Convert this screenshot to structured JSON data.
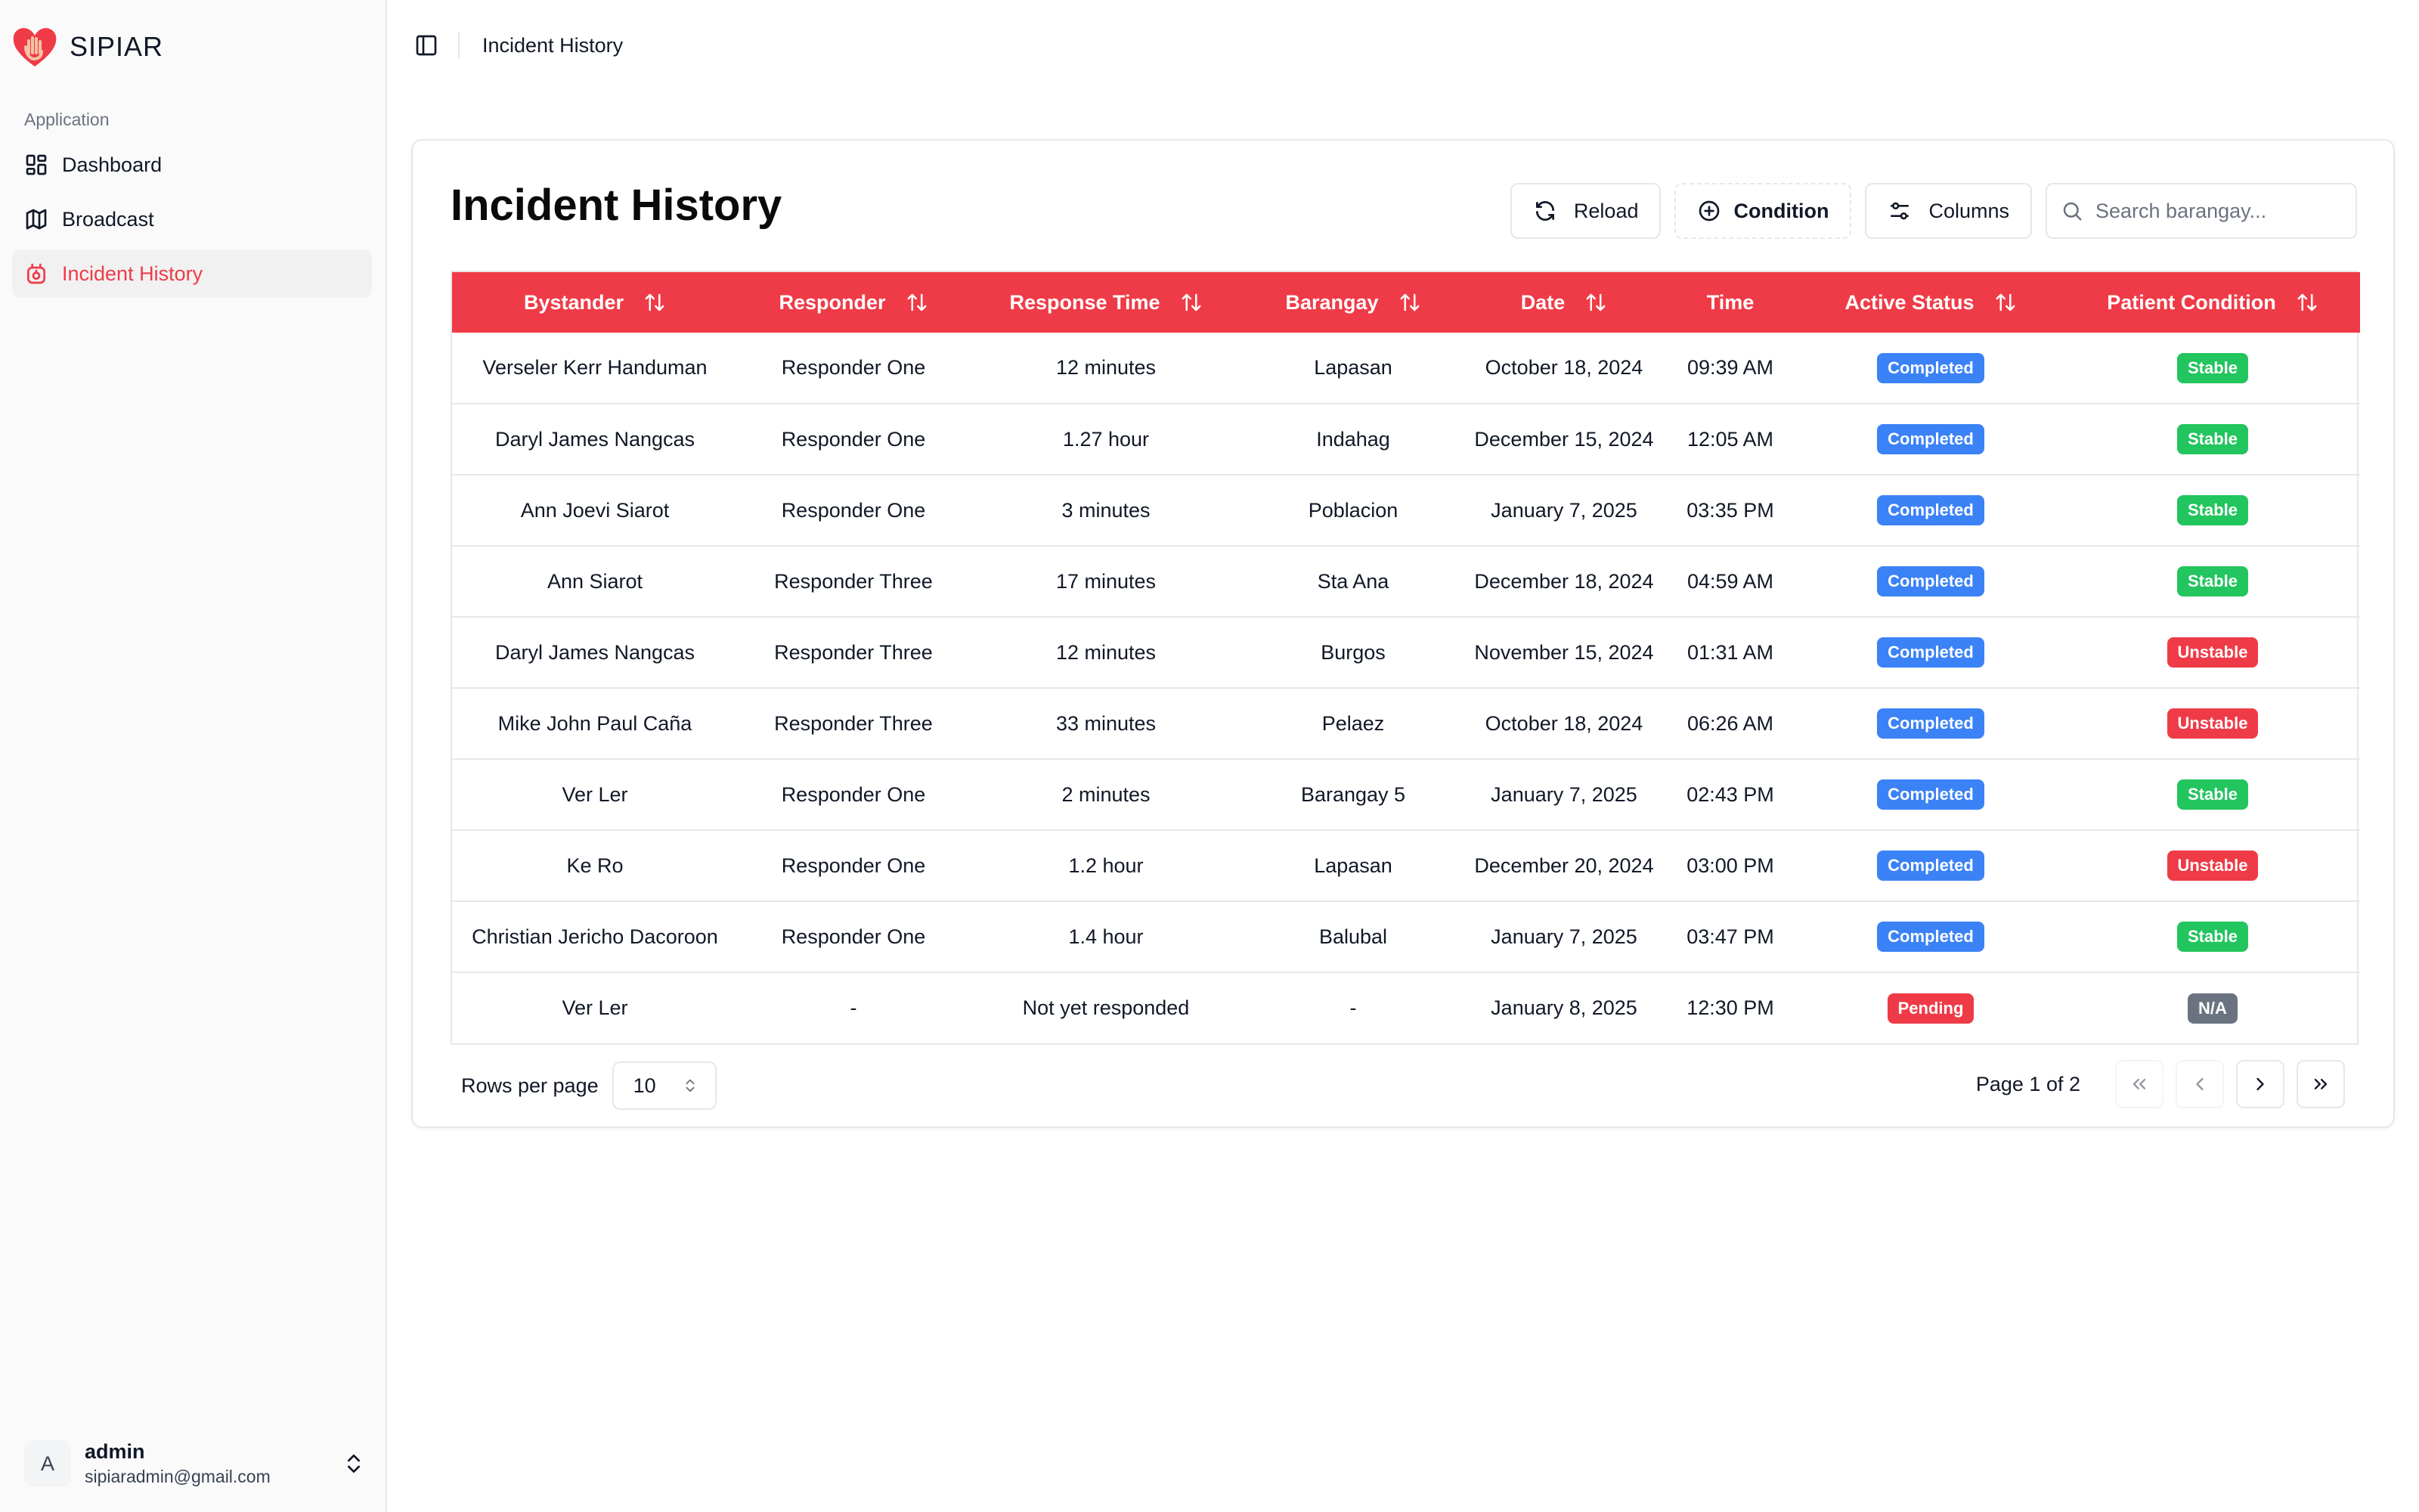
{
  "app": {
    "name": "SIPIAR"
  },
  "sidebar": {
    "group_label": "Application",
    "items": [
      {
        "label": "Dashboard",
        "icon": "layout-dashboard-icon",
        "active": false
      },
      {
        "label": "Broadcast",
        "icon": "map-icon",
        "active": true
      },
      {
        "label": "Incident History",
        "icon": "incident-history-icon",
        "active": true
      }
    ],
    "user": {
      "initial": "A",
      "name": "admin",
      "email": "sipiaradmin@gmail.com"
    }
  },
  "header": {
    "breadcrumb": "Incident History"
  },
  "main": {
    "title": "Incident History",
    "toolbar": {
      "reload_label": "Reload",
      "condition_label": "Condition",
      "columns_label": "Columns",
      "search_placeholder": "Search barangay..."
    },
    "table": {
      "columns": [
        "Bystander",
        "Responder",
        "Response Time",
        "Barangay",
        "Date",
        "Time",
        "Active Status",
        "Patient Condition"
      ],
      "rows": [
        {
          "bystander": "Verseler Kerr Handuman",
          "responder": "Responder One",
          "response_time": "12 minutes",
          "barangay": "Lapasan",
          "date": "October 18, 2024",
          "time": "09:39 AM",
          "status": "Completed",
          "condition": "Stable"
        },
        {
          "bystander": "Daryl James Nangcas",
          "responder": "Responder One",
          "response_time": "1.27 hour",
          "barangay": "Indahag",
          "date": "December 15, 2024",
          "time": "12:05 AM",
          "status": "Completed",
          "condition": "Stable"
        },
        {
          "bystander": "Ann Joevi Siarot",
          "responder": "Responder One",
          "response_time": "3 minutes",
          "barangay": "Poblacion",
          "date": "January 7, 2025",
          "time": "03:35 PM",
          "status": "Completed",
          "condition": "Stable"
        },
        {
          "bystander": "Ann Siarot",
          "responder": "Responder Three",
          "response_time": "17 minutes",
          "barangay": "Sta Ana",
          "date": "December 18, 2024",
          "time": "04:59 AM",
          "status": "Completed",
          "condition": "Stable"
        },
        {
          "bystander": "Daryl James Nangcas",
          "responder": "Responder Three",
          "response_time": "12 minutes",
          "barangay": "Burgos",
          "date": "November 15, 2024",
          "time": "01:31 AM",
          "status": "Completed",
          "condition": "Unstable"
        },
        {
          "bystander": "Mike John Paul Caña",
          "responder": "Responder Three",
          "response_time": "33 minutes",
          "barangay": "Pelaez",
          "date": "October 18, 2024",
          "time": "06:26 AM",
          "status": "Completed",
          "condition": "Unstable"
        },
        {
          "bystander": "Ver Ler",
          "responder": "Responder One",
          "response_time": "2 minutes",
          "barangay": "Barangay 5",
          "date": "January 7, 2025",
          "time": "02:43 PM",
          "status": "Completed",
          "condition": "Stable"
        },
        {
          "bystander": "Ke Ro",
          "responder": "Responder One",
          "response_time": "1.2 hour",
          "barangay": "Lapasan",
          "date": "December 20, 2024",
          "time": "03:00 PM",
          "status": "Completed",
          "condition": "Unstable"
        },
        {
          "bystander": "Christian Jericho Dacoroon",
          "responder": "Responder One",
          "response_time": "1.4 hour",
          "barangay": "Balubal",
          "date": "January 7, 2025",
          "time": "03:47 PM",
          "status": "Completed",
          "condition": "Stable"
        },
        {
          "bystander": "Ver Ler",
          "responder": "-",
          "response_time": "Not yet responded",
          "barangay": "-",
          "date": "January 8, 2025",
          "time": "12:30 PM",
          "status": "Pending",
          "condition": "N/A"
        }
      ]
    },
    "pagination": {
      "rows_per_page_label": "Rows per page",
      "rows_per_page_value": "10",
      "page_info": "Page 1 of 2"
    }
  },
  "colors": {
    "brand": "#ef3b47",
    "completed": "#3b82f6",
    "pending": "#ef3b47",
    "stable": "#22c55e",
    "unstable": "#ef3b47",
    "na": "#6b7280"
  }
}
